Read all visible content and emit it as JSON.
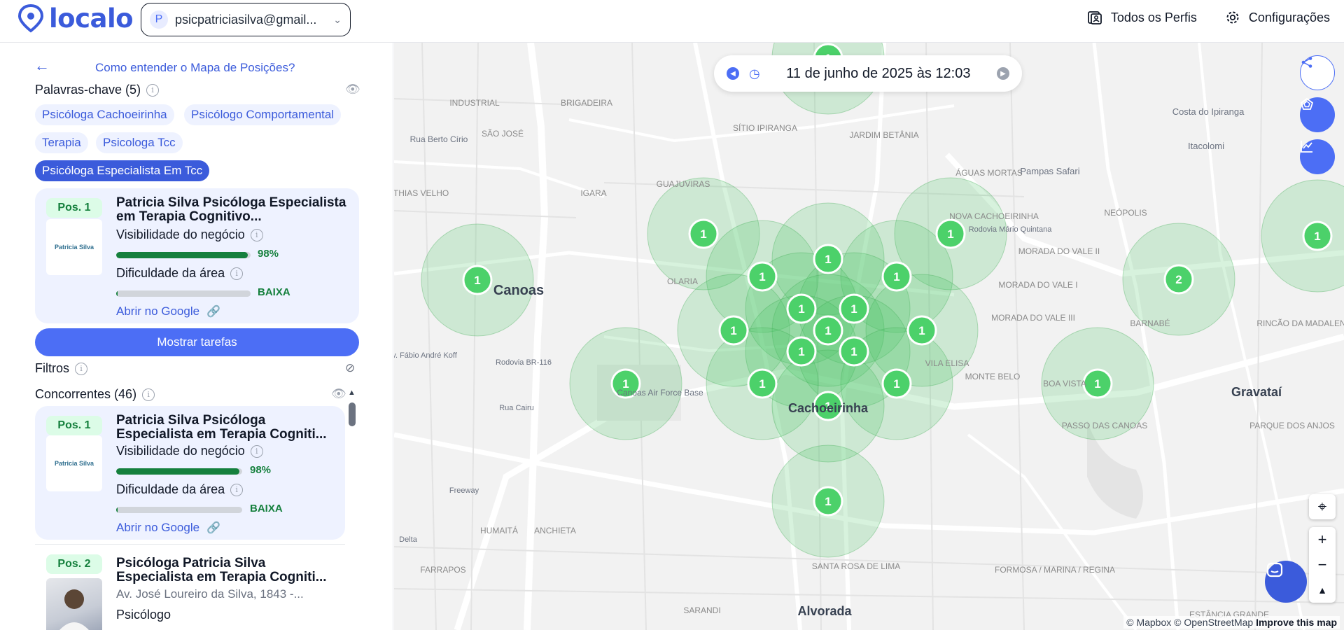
{
  "header": {
    "logo_text": "localo",
    "account_initial": "P",
    "account_email": "psicpatriciasilva@gmail...",
    "all_profiles": "Todos os Perfis",
    "settings": "Configurações"
  },
  "sidebar": {
    "help_link": "Como entender o Mapa de Posições?",
    "keywords_title": "Palavras-chave (5)",
    "keywords": [
      {
        "label": "Psicóloga Cachoeirinha",
        "active": false
      },
      {
        "label": "Psicólogo Comportamental",
        "active": false
      },
      {
        "label": "Terapia",
        "active": false
      },
      {
        "label": "Psicologa Tcc",
        "active": false
      },
      {
        "label": "Psicóloga Especialista Em Tcc",
        "active": true
      }
    ],
    "main_card": {
      "position": "Pos. 1",
      "brand": "Patricia Silva",
      "name": "Patricia Silva Psicóloga Especialista em Terapia Cognitivo...",
      "visibility_label": "Visibilidade do negócio",
      "visibility_pct": 98,
      "visibility_text": "98%",
      "difficulty_label": "Dificuldade da área",
      "difficulty_fill": 1,
      "difficulty_text": "BAIXA",
      "google_link": "Abrir no Google"
    },
    "tasks_button": "Mostrar tarefas",
    "filters_title": "Filtros",
    "competitors_title": "Concorrentes (46)",
    "competitors": [
      {
        "position": "Pos. 1",
        "brand": "Patricia Silva",
        "name": "Patricia Silva Psicóloga Especialista em Terapia Cogniti...",
        "visibility_label": "Visibilidade do negócio",
        "visibility_pct": 98,
        "visibility_text": "98%",
        "difficulty_label": "Dificuldade da área",
        "difficulty_text": "BAIXA",
        "google_link": "Abrir no Google"
      },
      {
        "position": "Pos. 2",
        "name": "Psicóloga Patricia Silva Especialista em Terapia Cogniti...",
        "address": "Av. José Loureiro da Silva, 1843 -...",
        "category": "Psicólogo"
      }
    ]
  },
  "map": {
    "date_text": "11 de junho de 2025 às 12:03",
    "pins": [
      {
        "label": "1"
      },
      {
        "label": "1"
      },
      {
        "label": "1"
      },
      {
        "label": "1"
      },
      {
        "label": "2"
      },
      {
        "label": "1"
      },
      {
        "label": "1"
      },
      {
        "label": "1"
      },
      {
        "label": "1"
      },
      {
        "label": "1"
      },
      {
        "label": "1"
      },
      {
        "label": "1"
      },
      {
        "label": "1"
      },
      {
        "label": "1"
      },
      {
        "label": "1"
      },
      {
        "label": "1"
      },
      {
        "label": "1"
      },
      {
        "label": "1"
      },
      {
        "label": "1"
      },
      {
        "label": "1"
      },
      {
        "label": "1"
      },
      {
        "label": "1"
      }
    ],
    "places": [
      "Canoas",
      "Cachoeirinha",
      "Gravataí",
      "Alvorada",
      "INDUSTRIAL",
      "BRIGADEIRA",
      "SÃO JOSÉ",
      "SÍTIO IPIRANGA",
      "JARDIM BETÂNIA",
      "GUAJUVIRAS",
      "IGARA",
      "MATHIAS VELHO",
      "OLARIA",
      "ÁGUAS MORTAS",
      "NOVA CACHOEIRINHA",
      "MORADA DO VALE II",
      "MORADA DO VALE I",
      "MORADA DO VALE III",
      "NEÓPOLIS",
      "Pampas Safari",
      "Itacolomi",
      "Costa do Ipiranga",
      "BARNABÉ",
      "RINCÃO DA MADALENA",
      "VILA ELISA",
      "MONTE BELO",
      "BOA VISTA",
      "PASSO DAS CANOAS",
      "PARQUE DOS ANJOS",
      "Canoas Air Force Base",
      "Freeway",
      "HUMAITÁ",
      "ANCHIETA",
      "FARRAPOS",
      "SANTA ROSA DE LIMA",
      "FORMOSA / MARINA / REGINA",
      "SARANDI",
      "ESTÂNCIA GRANDE",
      "Rua Berto Círio",
      "Rodovia BR-116",
      "Rua Cairu",
      "Rodovia Mário Quintana",
      "Av. Fábio André Koff",
      "Delta"
    ],
    "attribution_mapbox": "© Mapbox",
    "attribution_osm": "© OpenStreetMap",
    "attribution_improve": "Improve this map"
  }
}
